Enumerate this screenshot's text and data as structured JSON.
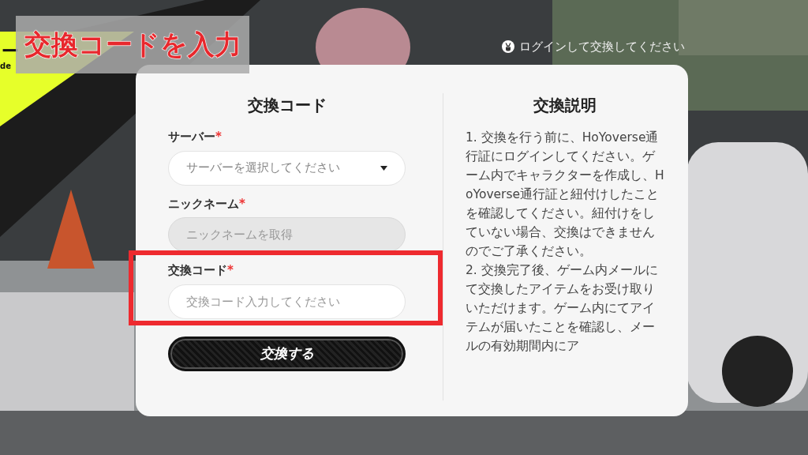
{
  "banner": {
    "title_fragment": "ー",
    "subtitle_fragment": "de"
  },
  "annotation": {
    "caption": "交換コードを入力"
  },
  "login_prompt": {
    "text": "ログインして交換してください"
  },
  "form": {
    "title": "交換コード",
    "fields": [
      {
        "kind": "select",
        "label": "サーバー",
        "required_mark": "*",
        "placeholder": "サーバーを選択してください",
        "disabled": false,
        "highlighted": false
      },
      {
        "kind": "text",
        "label": "ニックネーム",
        "required_mark": "*",
        "placeholder": "ニックネームを取得",
        "disabled": true,
        "highlighted": false
      },
      {
        "kind": "text",
        "label": "交換コード",
        "required_mark": "*",
        "placeholder": "交換コード入力してください",
        "disabled": false,
        "highlighted": true
      }
    ],
    "submit": "交換する"
  },
  "instructions": {
    "title": "交換説明",
    "paragraphs": [
      "1. 交換を行う前に、HoYoverse通行証にログインしてください。ゲーム内でキャラクターを作成し、HoYoverse通行証と紐付けしたことを確認してください。紐付けをしていない場合、交換はできませんのでご了承ください。",
      "2. 交換完了後、ゲーム内メールにて交換したアイテムをお受け取りいただけます。ゲーム内にてアイテムが届いたことを確認し、メールの有効期間内にア"
    ]
  }
}
